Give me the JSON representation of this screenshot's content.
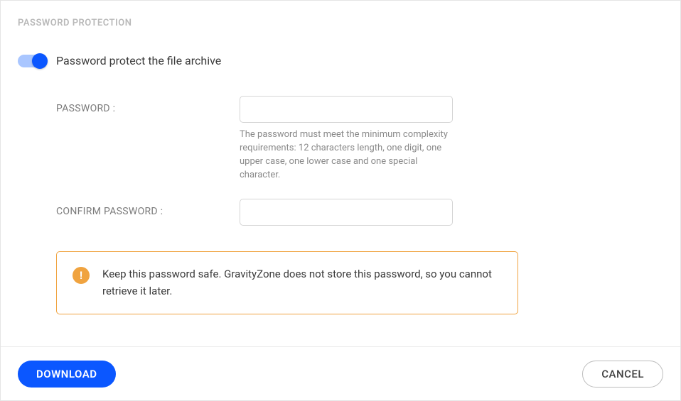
{
  "section_title": "PASSWORD PROTECTION",
  "toggle": {
    "label": "Password protect the file archive"
  },
  "password_field": {
    "label": "PASSWORD :",
    "value": "",
    "help": "The password must meet the minimum complexity requirements: 12 characters length, one digit, one upper case, one lower case and one special character."
  },
  "confirm_field": {
    "label": "CONFIRM PASSWORD :",
    "value": ""
  },
  "alert": {
    "text": "Keep this password safe. GravityZone does not store this password, so you cannot retrieve it later."
  },
  "footer": {
    "download_label": "DOWNLOAD",
    "cancel_label": "CANCEL"
  }
}
